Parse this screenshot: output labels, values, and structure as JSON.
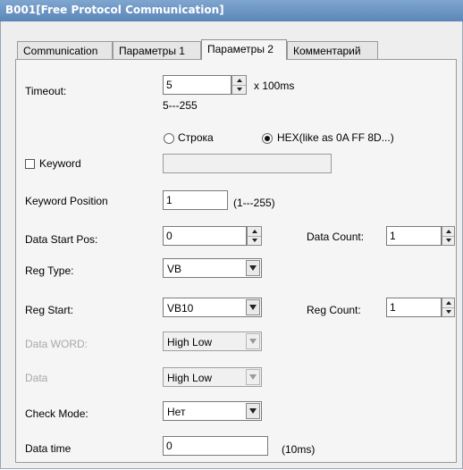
{
  "window": {
    "title": "B001[Free Protocol Communication]"
  },
  "tabs": [
    {
      "label": "Communication",
      "active": false
    },
    {
      "label": "Параметры 1",
      "active": false
    },
    {
      "label": "Параметры 2",
      "active": true
    },
    {
      "label": "Комментарий",
      "active": false
    }
  ],
  "form": {
    "timeout": {
      "label": "Timeout:",
      "value": "5",
      "unit": "x 100ms",
      "range": "5---255"
    },
    "mode": {
      "options": [
        {
          "label": "Строка",
          "selected": false
        },
        {
          "label": "HEX(like as 0A FF 8D...)",
          "selected": true
        }
      ]
    },
    "keyword": {
      "label": "Keyword",
      "checked": false,
      "value": ""
    },
    "keyword_position": {
      "label": "Keyword Position",
      "value": "1",
      "range": "(1---255)"
    },
    "data_start_pos": {
      "label": "Data Start Pos:",
      "value": "0"
    },
    "data_count": {
      "label": "Data Count:",
      "value": "1"
    },
    "reg_type": {
      "label": "Reg Type:",
      "value": "VB"
    },
    "reg_start": {
      "label": "Reg Start:",
      "value": "VB10"
    },
    "reg_count": {
      "label": "Reg Count:",
      "value": "1"
    },
    "data_word": {
      "label": "Data WORD:",
      "value": "High Low",
      "disabled": true
    },
    "data": {
      "label": "Data",
      "value": "High Low",
      "disabled": true
    },
    "check_mode": {
      "label": "Check Mode:",
      "value": "Нет"
    },
    "data_time": {
      "label": "Data time",
      "value": "0",
      "unit": "(10ms)"
    }
  },
  "colors": {
    "titlebar": "#6b93c2",
    "panel": "#f5f5f5",
    "disabled_text": "#a8a8a8"
  }
}
